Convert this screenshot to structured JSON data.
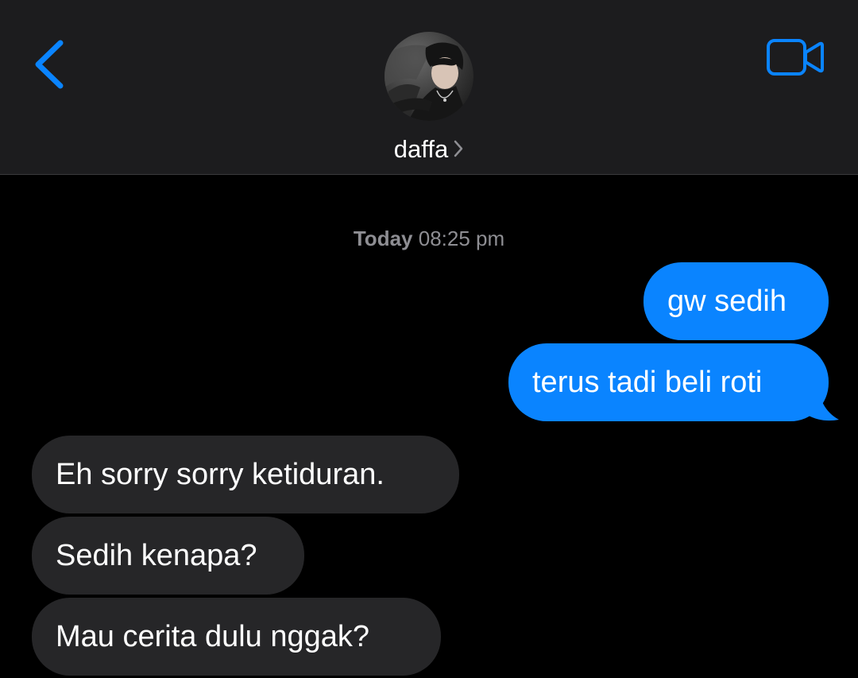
{
  "header": {
    "contact_name": "daffa",
    "back_icon": "chevron-left-icon",
    "video_icon": "video-camera-icon",
    "accent_color": "#0a84ff"
  },
  "conversation": {
    "timestamp_day": "Today",
    "timestamp_time": "08:25 pm",
    "messages": [
      {
        "sender": "me",
        "text": "gw sedih"
      },
      {
        "sender": "me",
        "text": "terus tadi beli roti"
      },
      {
        "sender": "them",
        "text": "Eh sorry sorry ketiduran."
      },
      {
        "sender": "them",
        "text": "Sedih kenapa?"
      },
      {
        "sender": "them",
        "text": "Mau cerita dulu nggak?"
      }
    ]
  },
  "colors": {
    "outgoing_bubble": "#0a84ff",
    "incoming_bubble": "#262628",
    "background": "#000000",
    "header_background": "#1c1c1e"
  }
}
